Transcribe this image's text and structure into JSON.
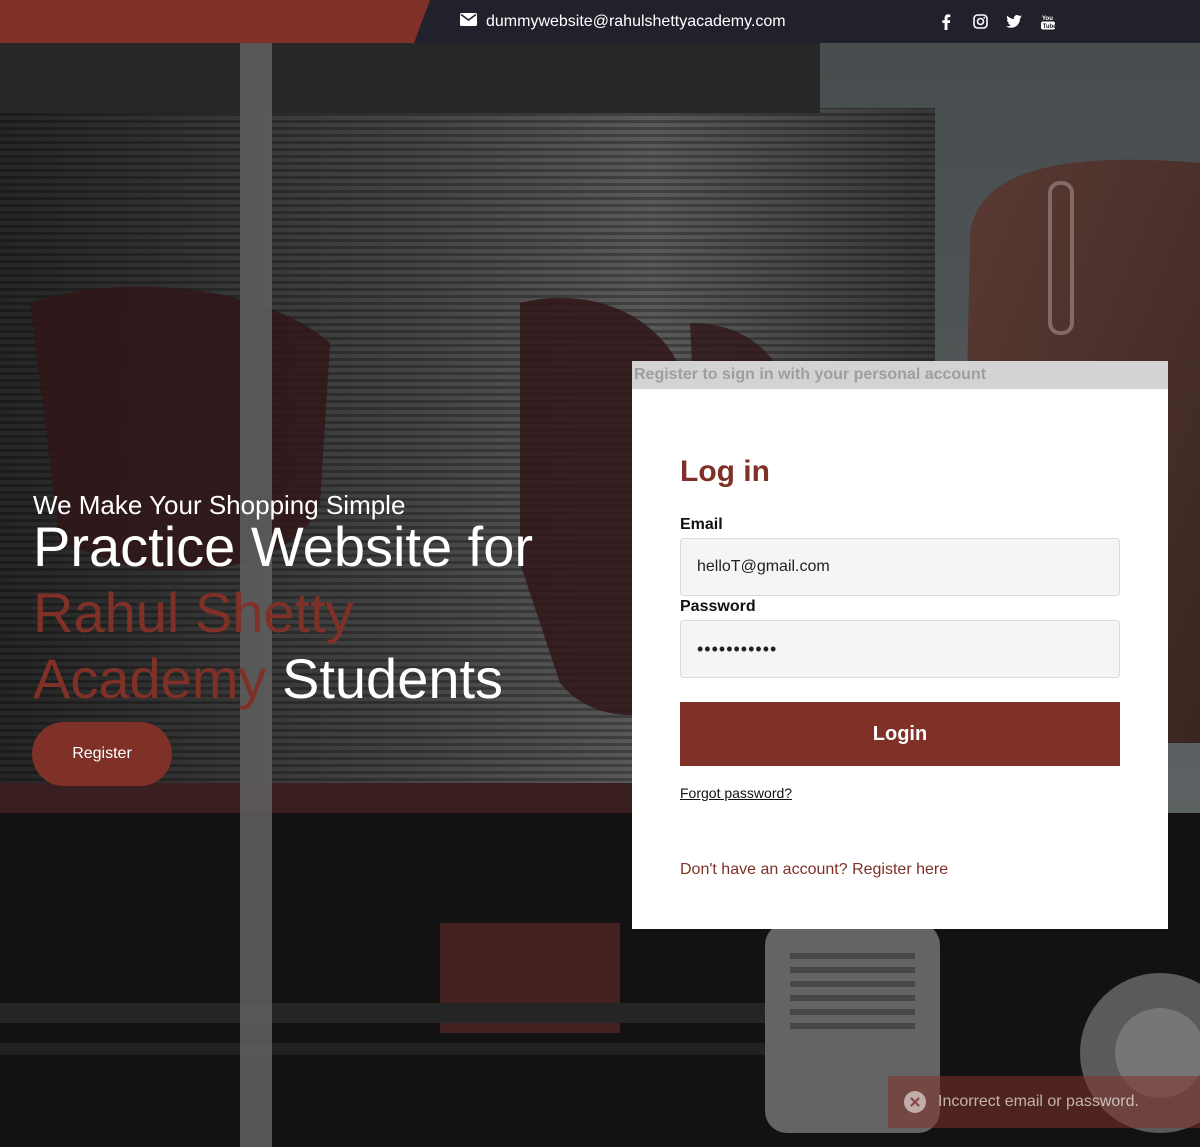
{
  "topbar": {
    "email": "dummywebsite@rahulshettyacademy.com",
    "social": [
      {
        "icon": "facebook-icon"
      },
      {
        "icon": "instagram-icon"
      },
      {
        "icon": "twitter-icon"
      },
      {
        "icon": "youtube-icon"
      }
    ]
  },
  "hero": {
    "tagline": "We Make Your Shopping Simple",
    "headline_part1": "Practice Website for",
    "headline_accent": "Rahul Shetty Academy",
    "headline_part2": "Students",
    "register_label": "Register"
  },
  "login": {
    "banner": "Register to sign in with your personal account",
    "title": "Log in",
    "email_label": "Email",
    "email_value": "helloT@gmail.com",
    "password_label": "Password",
    "password_value": "•••••••••••",
    "login_label": "Login",
    "forgot_label": "Forgot password?",
    "register_label": "Don't have an account? Register here"
  },
  "toast": {
    "message": "Incorrect email or password."
  },
  "colors": {
    "brand": "#7f3027",
    "topbar": "#20212b",
    "card_header": "#d3d3d3"
  }
}
